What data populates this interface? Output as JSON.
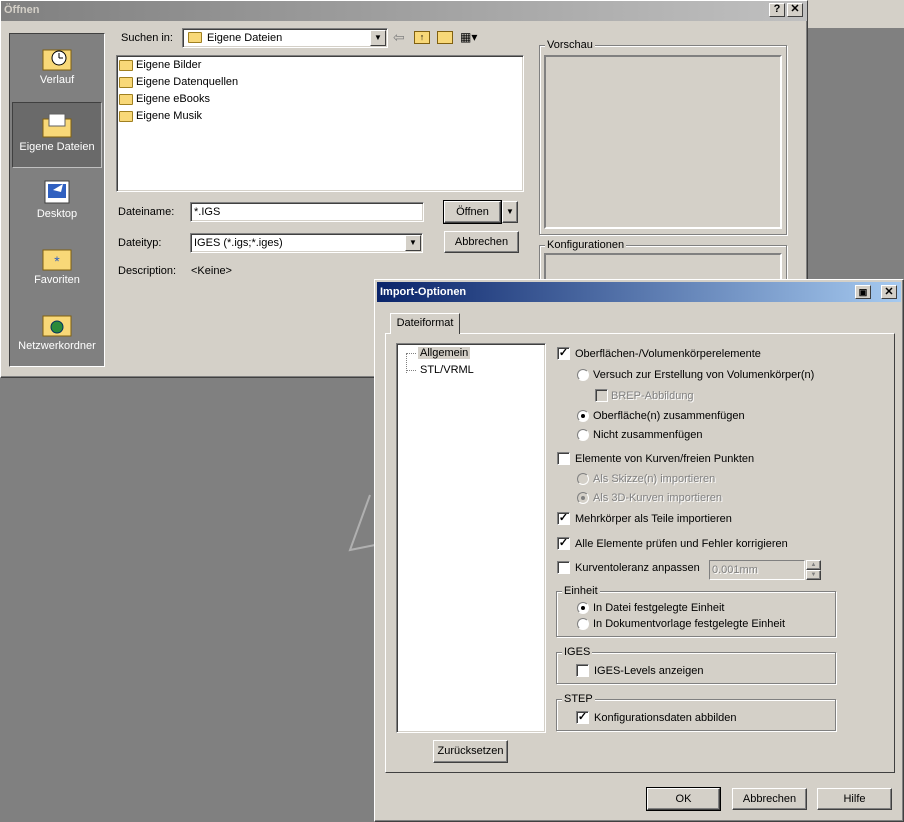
{
  "open_dialog": {
    "title": "Öffnen",
    "help_glyph": "?",
    "close_glyph": "✕",
    "sidebar": [
      {
        "label": "Verlauf",
        "icon": "history-icon"
      },
      {
        "label": "Eigene Dateien",
        "icon": "my-documents-icon"
      },
      {
        "label": "Desktop",
        "icon": "desktop-icon"
      },
      {
        "label": "Favoriten",
        "icon": "favorites-icon"
      },
      {
        "label": "Netzwerkordner",
        "icon": "network-folder-icon"
      }
    ],
    "look_in_label": "Suchen in:",
    "look_in_value": "Eigene Dateien",
    "files": [
      "Eigene Bilder",
      "Eigene Datenquellen",
      "Eigene eBooks",
      "Eigene Musik"
    ],
    "filename_label": "Dateiname:",
    "filename_value": "*.IGS",
    "filetype_label": "Dateityp:",
    "filetype_value": "IGES (*.igs;*.iges)",
    "description_label": "Description:",
    "description_value": "<Keine>",
    "open_button": "Öffnen",
    "cancel_button": "Abbrechen",
    "preview_label": "Vorschau",
    "config_label": "Konfigurationen"
  },
  "import_dialog": {
    "title": "Import-Optionen",
    "close_glyph": "✕",
    "tab_label": "Dateiformat",
    "tree": [
      "Allgemein",
      "STL/VRML"
    ],
    "reset_button": "Zurücksetzen",
    "ok_button": "OK",
    "cancel_button": "Abbrechen",
    "help_button": "Hilfe",
    "options": {
      "surfaces": {
        "label": "Oberflächen-/Volumenkörperelemente",
        "checked": true
      },
      "try_solid": {
        "label": "Versuch zur Erstellung von Volumenkörper(n)",
        "selected": false
      },
      "brep": {
        "label": "BREP-Abbildung",
        "checked": false,
        "disabled": true
      },
      "knit": {
        "label": "Oberfläche(n) zusammenfügen",
        "selected": true
      },
      "no_knit": {
        "label": "Nicht zusammenfügen",
        "selected": false
      },
      "curves": {
        "label": "Elemente von Kurven/freien Punkten",
        "checked": false
      },
      "as_sketch": {
        "label": "Als Skizze(n) importieren",
        "disabled": true
      },
      "as_3d": {
        "label": "Als 3D-Kurven importieren",
        "disabled": true,
        "selected": true
      },
      "multibody": {
        "label": "Mehrkörper als Teile importieren",
        "checked": true
      },
      "check_all": {
        "label": "Alle Elemente prüfen und Fehler korrigieren",
        "checked": true
      },
      "tolerance": {
        "label": "Kurventoleranz anpassen",
        "checked": false,
        "value": "0.001mm"
      }
    },
    "unit_group": {
      "label": "Einheit",
      "file_unit": "In Datei festgelegte Einheit",
      "doc_unit": "In Dokumentvorlage festgelegte Einheit"
    },
    "iges_group": {
      "label": "IGES",
      "levels": "IGES-Levels anzeigen"
    },
    "step_group": {
      "label": "STEP",
      "config": "Konfigurationsdaten abbilden"
    }
  }
}
